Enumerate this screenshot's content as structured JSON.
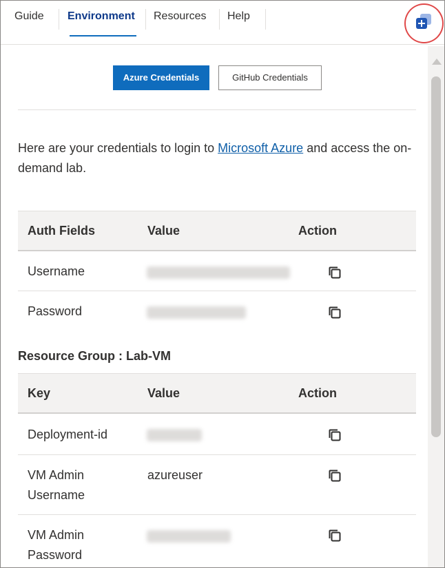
{
  "nav": {
    "tabs": [
      {
        "label": "Guide",
        "active": false
      },
      {
        "label": "Environment",
        "active": true
      },
      {
        "label": "Resources",
        "active": false
      },
      {
        "label": "Help",
        "active": false
      }
    ],
    "new_window_icon": "open-in-new-window-icon"
  },
  "credentials_tabs": {
    "azure_label": "Azure Credentials",
    "github_label": "GitHub Credentials"
  },
  "intro": {
    "before": "Here are your credentials to login to ",
    "link": "Microsoft Azure",
    "after": " and access the on-demand lab."
  },
  "auth_table": {
    "headers": [
      "Auth Fields",
      "Value",
      "Action"
    ],
    "rows": [
      {
        "field": "Username",
        "value_hidden": true
      },
      {
        "field": "Password",
        "value_hidden": true
      }
    ]
  },
  "resource_group": {
    "title": "Resource Group : Lab-VM",
    "headers": [
      "Key",
      "Value",
      "Action"
    ],
    "rows": [
      {
        "key": "Deployment-id",
        "value_hidden": true
      },
      {
        "key": "VM Admin Username",
        "value": "azureuser"
      },
      {
        "key": "VM Admin Password",
        "value_hidden": true
      }
    ]
  },
  "colors": {
    "accent": "#0f6cbd",
    "active_tab_text": "#0f3a8a",
    "highlight_circle": "#e04848",
    "link": "#0f5fa8"
  }
}
